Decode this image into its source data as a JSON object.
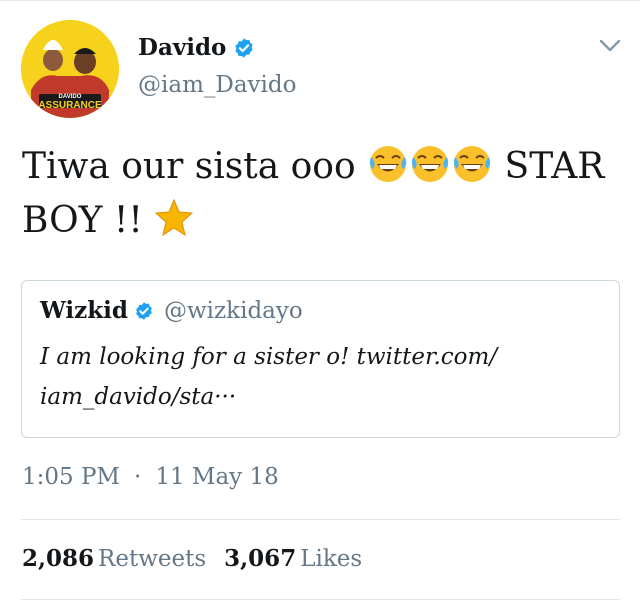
{
  "author": {
    "name": "Davido",
    "handle": "@iam_Davido",
    "verified": true,
    "avatar_text_top": "DAVIDO",
    "avatar_text_bottom": "ASSURANCE"
  },
  "tweet": {
    "text_part1": "Tiwa our sista ooo",
    "text_part2": "STAR",
    "text_part3": "BOY !!",
    "emojis": [
      "face-with-tears-of-joy",
      "face-with-tears-of-joy",
      "face-with-tears-of-joy",
      "star"
    ]
  },
  "quoted_tweet": {
    "name": "Wizkid",
    "handle": "@wizkidayo",
    "verified": true,
    "text_line1": "I am looking for a sister o! twitter.com/",
    "text_line2": "iam_davido/sta···"
  },
  "meta": {
    "time": "1:05 PM",
    "separator": "·",
    "date": "11 May 18"
  },
  "stats": {
    "retweets_count": "2,086",
    "retweets_label": "Retweets",
    "likes_count": "3,067",
    "likes_label": "Likes"
  },
  "colors": {
    "text": "#14171a",
    "secondary": "#657786",
    "verified_blue": "#1da1f2",
    "border": "#ccd6dd"
  }
}
